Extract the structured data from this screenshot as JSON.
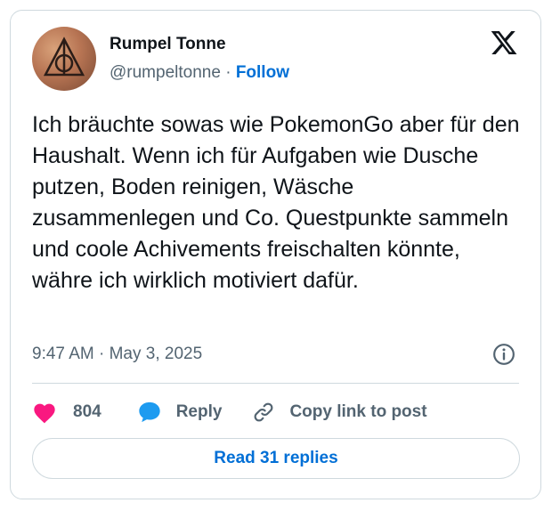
{
  "author": {
    "name": "Rumpel Tonne",
    "handle": "@rumpeltonne",
    "separator": "·",
    "follow_label": "Follow",
    "avatar_icon": "deathly-hallows-tattoo-avatar"
  },
  "tweet": {
    "text": "Ich bräuchte sowas wie PokemonGo aber für den Haushalt. Wenn ich für Aufgaben wie Dusche putzen, Boden reinigen, Wäsche zusammenlegen und Co. Questpunkte sammeln und coole Achivements freischalten könnte, währe ich wirklich motiviert dafür.",
    "timestamp": "9:47 AM · May 3, 2025"
  },
  "actions": {
    "like_count": "804",
    "reply_label": "Reply",
    "copy_label": "Copy link to post"
  },
  "read_replies_label": "Read 31 replies",
  "colors": {
    "like": "#f91880",
    "reply": "#1d9bf0",
    "link": "#006fd6",
    "muted": "#536471",
    "border": "#cfd9de"
  },
  "icons": [
    "x-logo-icon",
    "info-icon",
    "heart-icon",
    "reply-bubble-icon",
    "link-icon"
  ]
}
